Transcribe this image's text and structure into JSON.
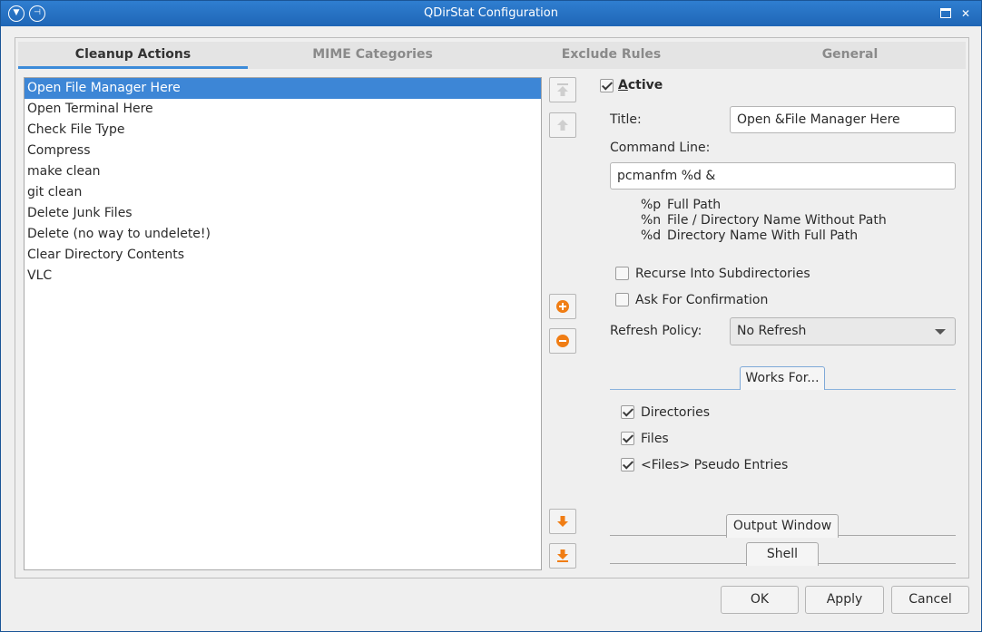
{
  "window": {
    "title": "QDirStat Configuration"
  },
  "tabs": [
    {
      "label": "Cleanup Actions",
      "active": true
    },
    {
      "label": "MIME Categories",
      "active": false
    },
    {
      "label": "Exclude Rules",
      "active": false
    },
    {
      "label": "General",
      "active": false
    }
  ],
  "cleanups": [
    "Open File Manager Here",
    "Open Terminal Here",
    "Check File Type",
    "Compress",
    "make clean",
    "git clean",
    "Delete Junk Files",
    "Delete (no way to undelete!)",
    "Clear Directory Contents",
    "VLC"
  ],
  "selected_index": 0,
  "side_buttons": {
    "move_to_top": "arrow-to-top-icon",
    "move_up": "arrow-up-icon",
    "add": "plus-circle-icon",
    "remove": "minus-circle-icon",
    "move_down": "arrow-down-icon",
    "move_to_bottom": "arrow-to-bottom-icon"
  },
  "details": {
    "active_label": "Active",
    "active_checked": true,
    "title_label": "Title:",
    "title_value": "Open &File Manager Here",
    "command_label": "Command Line:",
    "command_value": "pcmanfm %d &",
    "help": [
      {
        "key": "%p",
        "text": "Full Path"
      },
      {
        "key": "%n",
        "text": "File / Directory Name Without Path"
      },
      {
        "key": "%d",
        "text": "Directory Name With Full Path"
      }
    ],
    "recurse_label": "Recurse Into Subdirectories",
    "recurse_checked": false,
    "confirm_label": "Ask For Confirmation",
    "confirm_checked": false,
    "refresh_label": "Refresh Policy:",
    "refresh_value": "No Refresh",
    "works_for_label": "Works For...",
    "directories_label": "Directories",
    "directories_checked": true,
    "files_label": "Files",
    "files_checked": true,
    "pseudo_label": "<Files> Pseudo Entries",
    "pseudo_checked": true,
    "output_window_label": "Output Window",
    "shell_label": "Shell"
  },
  "buttons": {
    "ok": "OK",
    "apply": "Apply",
    "cancel": "Cancel"
  },
  "colors": {
    "accent": "#3d86d6",
    "orange": "#f07d14",
    "titlebar": "#2474c6"
  }
}
